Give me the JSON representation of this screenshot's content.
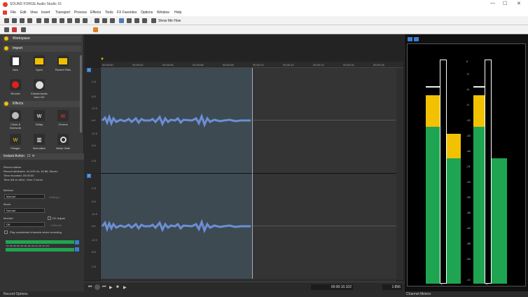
{
  "window": {
    "title": "SOUND FORGE Audio Studio 15",
    "min": "—",
    "max": "☐",
    "close": "✕"
  },
  "menu": [
    "File",
    "Edit",
    "View",
    "Insert",
    "Transport",
    "Process",
    "Effects",
    "Tools",
    "FX Favorites",
    "Options",
    "Window",
    "Help"
  ],
  "toolbar": {
    "show_me_how": "Show Me How"
  },
  "left": {
    "workspace": "Workspace",
    "import": "Import",
    "import_tiles": [
      "New",
      "Open",
      "Recent Files",
      "Record",
      "Extract Audio from CD"
    ],
    "effects": "Effects",
    "effect_tiles": [
      "Clone & Dereverb",
      "Delay",
      "Chorus",
      "Flanger",
      "Normalize",
      "Noise Gate"
    ]
  },
  "instant_action": {
    "title": "Instant Action",
    "record_status": "Record status:",
    "record_attributes": "Record attributes:  44,100 Hz; 16 Bit; Stereo",
    "time_recorded": "Time recorded:        00:00:00",
    "time_left": "Time left on drive: Over 2 hours",
    "method_label": "Method:",
    "method_value": "Manual",
    "settings_label": "Settings...",
    "mode_label": "Mode:",
    "mode_value": "Normal",
    "monitor_label": "Monitor:",
    "monitor_value": "Off",
    "dc_adjust": "DC Adjust",
    "calibrate": "Calibrate",
    "play_unselected": "Play unselected channels when recording",
    "meter_scale": "-72 -66 -60 -54 -48 -42 -36 -30 -24 -18 -12 -6 0"
  },
  "ruler_ticks": [
    "00:00:00",
    "00:00:02",
    "00:00:04",
    "00:00:06",
    "00:00:08",
    "00:00:10",
    "00:00:12",
    "00:00:14",
    "00:00:16",
    "00:00:18"
  ],
  "scale_labels": [
    "-2.5",
    "-6.0",
    "-12.0",
    "-Inf.",
    "-12.0",
    "-6.0",
    "-2.5"
  ],
  "status": {
    "position": "00:00:10.102",
    "zoom": "1:896"
  },
  "tabs": {
    "left_bottom": "Record Options",
    "right_bottom": "Channel Meters"
  },
  "meter_scale": [
    "0",
    "-3",
    "-6",
    "-9",
    "-12",
    "-15",
    "-18",
    "-21",
    "-24",
    "-30",
    "-36",
    "-42",
    "-48",
    "-54",
    "-72"
  ],
  "meter_levels": {
    "left": {
      "green": 0.7,
      "yellow": 0.14,
      "peak_line": 0.88
    },
    "right": {
      "green": 0.56,
      "yellow": 0.11,
      "peak_line": 0.74
    }
  },
  "meter_channel_labels": [
    "L",
    "R"
  ],
  "colors": {
    "accent": "#f0c000",
    "wave": "#6b8fd6",
    "meter_green": "#1fa552",
    "meter_yellow": "#f2c200"
  }
}
